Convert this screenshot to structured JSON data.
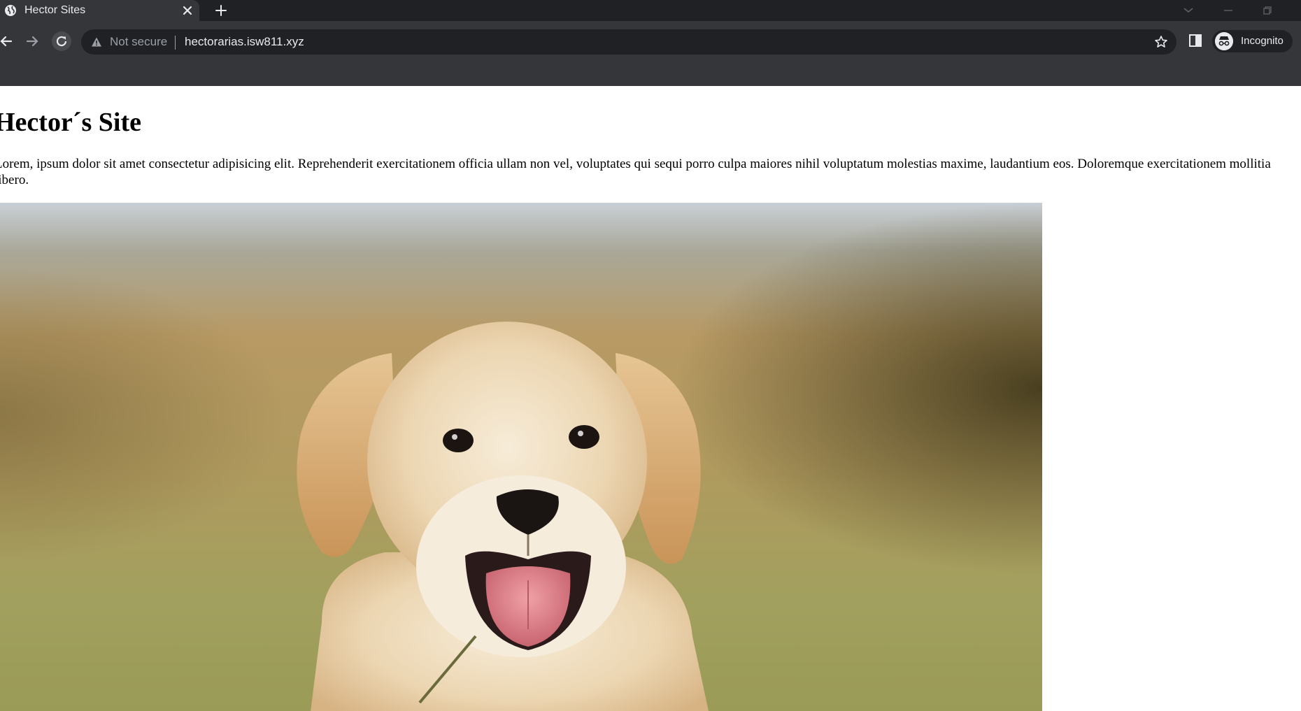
{
  "browser": {
    "tab": {
      "title": "Hector Sites"
    },
    "omnibox": {
      "security_label": "Not secure",
      "url": "hectorarias.isw811.xyz"
    },
    "profile": {
      "label": "Incognito"
    }
  },
  "page": {
    "heading": "Hector´s Site",
    "paragraph": "Lorem, ipsum dolor sit amet consectetur adipisicing elit. Reprehenderit exercitationem officia ullam non vel, voluptates qui sequi porro culpa maiores nihil voluptatum molestias maxime, laudantium eos. Doloremque exercitationem mollitia libero.",
    "image": {
      "subject": "golden retriever puppy"
    }
  },
  "icons": {
    "favicon": "globe-icon",
    "tab_close": "close-icon",
    "new_tab": "plus-icon",
    "back": "back-arrow-icon",
    "forward": "forward-arrow-icon",
    "reload": "reload-icon",
    "security": "warning-icon",
    "bookmark": "star-icon",
    "side_panel": "side-panel-icon",
    "incognito": "incognito-icon"
  },
  "colors": {
    "tabstrip": "#202124",
    "toolbar": "#35363a",
    "omnibox": "#202124",
    "chrome_text": "#e8eaed",
    "muted_text": "#9aa0a6",
    "page_background": "#ffffff"
  }
}
